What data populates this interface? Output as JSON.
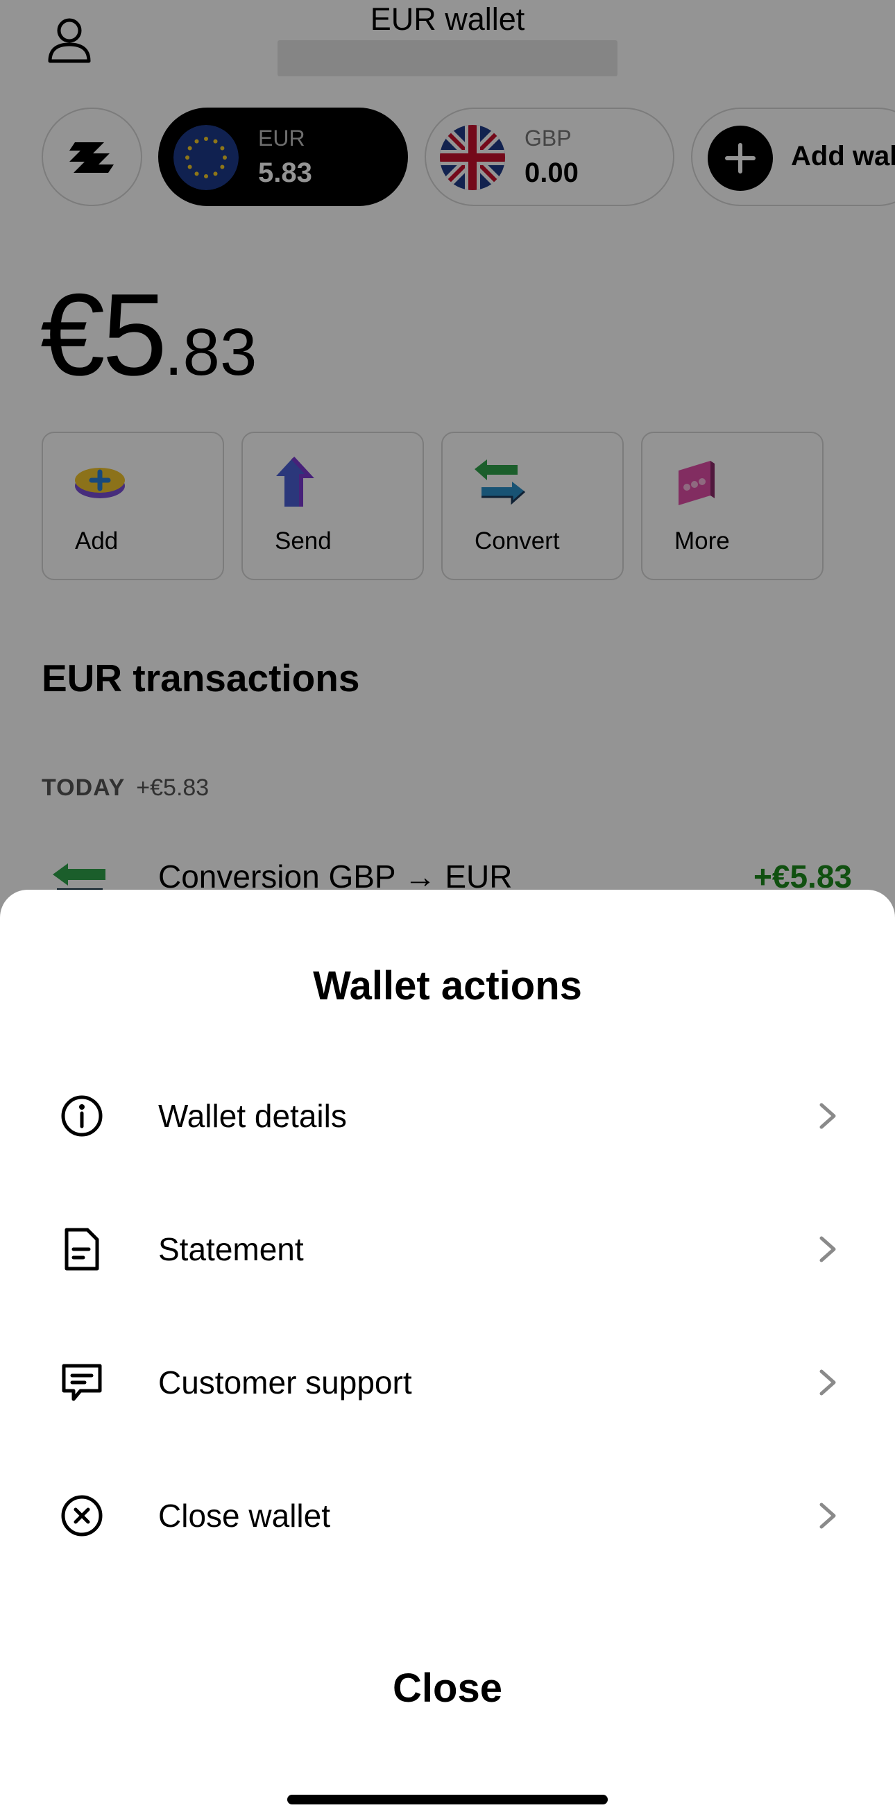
{
  "header": {
    "title": "EUR wallet"
  },
  "wallets": [
    {
      "code": "EUR",
      "amount": "5.83"
    },
    {
      "code": "GBP",
      "amount": "0.00"
    }
  ],
  "add_wallet_label": "Add wal",
  "balance": {
    "main": "€5",
    "decimal": ".83"
  },
  "actions": [
    {
      "label": "Add"
    },
    {
      "label": "Send"
    },
    {
      "label": "Convert"
    },
    {
      "label": "More"
    }
  ],
  "transactions": {
    "title": "EUR transactions",
    "day_label": "TODAY",
    "day_total": "+€5.83",
    "items": [
      {
        "name": "Conversion GBP → EUR",
        "amount": "+€5.83"
      }
    ]
  },
  "sheet": {
    "title": "Wallet actions",
    "items": [
      {
        "label": "Wallet details",
        "icon": "info-icon"
      },
      {
        "label": "Statement",
        "icon": "document-icon"
      },
      {
        "label": "Customer support",
        "icon": "chat-icon"
      },
      {
        "label": "Close wallet",
        "icon": "close-circle-icon"
      }
    ],
    "close_label": "Close"
  },
  "colors": {
    "positive": "#1c8a1c",
    "scrim": "rgba(0,0,0,0.42)"
  }
}
